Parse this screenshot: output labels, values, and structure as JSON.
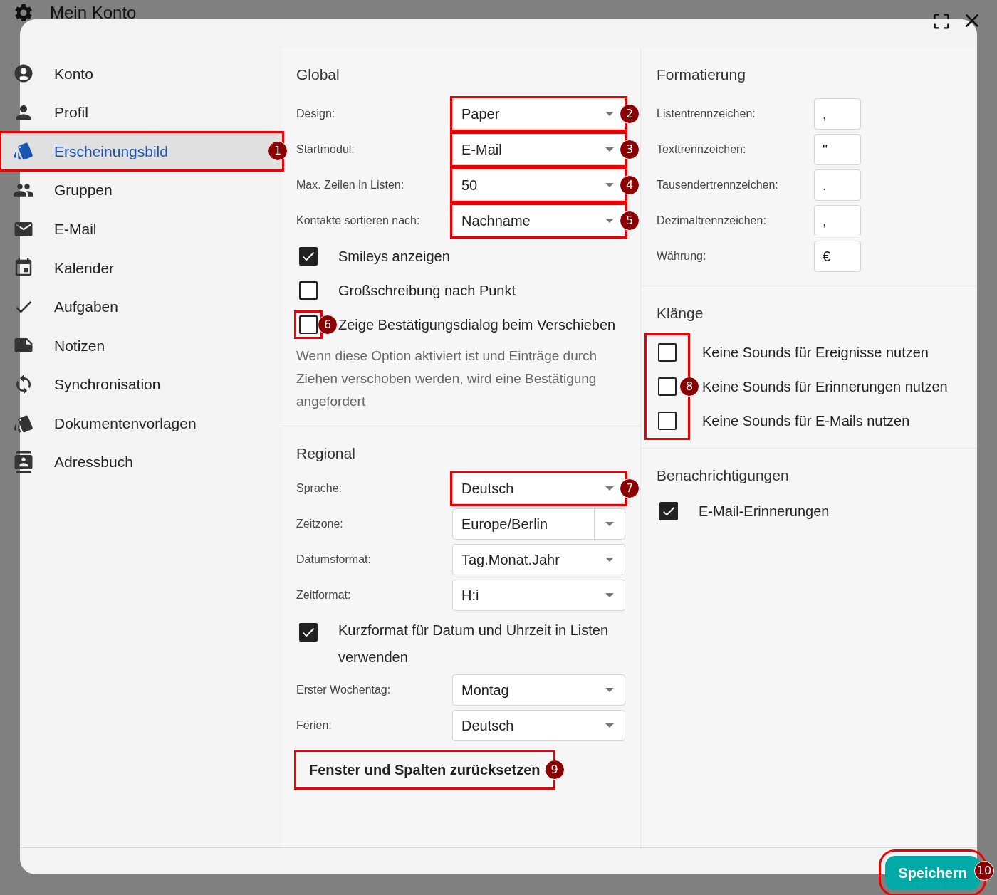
{
  "window": {
    "title": "Mein Konto"
  },
  "sidebar": {
    "items": [
      {
        "kind": "account",
        "label": "Konto",
        "selected": false
      },
      {
        "kind": "person",
        "label": "Profil",
        "selected": false
      },
      {
        "kind": "style",
        "label": "Erscheinungsbild",
        "selected": true,
        "highlighted": true,
        "badge": "1"
      },
      {
        "kind": "people",
        "label": "Gruppen",
        "selected": false
      },
      {
        "kind": "mail",
        "label": "E-Mail",
        "selected": false
      },
      {
        "kind": "calendar",
        "label": "Kalender",
        "selected": false
      },
      {
        "kind": "check",
        "label": "Aufgaben",
        "selected": false
      },
      {
        "kind": "note",
        "label": "Notizen",
        "selected": false
      },
      {
        "kind": "sync",
        "label": "Synchronisation",
        "selected": false
      },
      {
        "kind": "style",
        "label": "Dokumentenvorlagen",
        "selected": false
      },
      {
        "kind": "contacts",
        "label": "Adressbuch",
        "selected": false
      }
    ]
  },
  "global": {
    "heading": "Global",
    "highlighted": true,
    "fields": [
      {
        "kind": "select",
        "label": "Design:",
        "value": "Paper",
        "badge": "2"
      },
      {
        "kind": "select",
        "label": "Startmodul:",
        "value": "E-Mail",
        "badge": "3"
      },
      {
        "kind": "select",
        "label": "Max. Zeilen in Listen:",
        "value": "50",
        "badge": "4"
      },
      {
        "kind": "select",
        "label": "Kontakte sortieren nach:",
        "value": "Nachname",
        "badge": "5"
      }
    ],
    "checkboxes": [
      {
        "label": "Smileys anzeigen",
        "checked": true
      },
      {
        "label": "Großschreibung nach Punkt",
        "checked": false
      },
      {
        "label": "Zeige Bestätigungsdialog beim Verschieben",
        "checked": false,
        "highlighted": true,
        "badge": "6"
      }
    ],
    "hint": "Wenn diese Option aktiviert ist und Einträge durch Ziehen verschoben werden, wird eine Bestätigung angefordert"
  },
  "regional": {
    "heading": "Regional",
    "fields": [
      {
        "kind": "select",
        "label": "Sprache:",
        "value": "Deutsch",
        "highlighted": true,
        "badge": "7"
      },
      {
        "kind": "combo",
        "label": "Zeitzone:",
        "value": "Europe/Berlin"
      },
      {
        "kind": "select",
        "label": "Datumsformat:",
        "value": "Tag.Monat.Jahr"
      },
      {
        "kind": "select",
        "label": "Zeitformat:",
        "value": "H:i"
      }
    ],
    "checkbox": {
      "label": "Kurzformat für Datum und Uhrzeit in Listen verwenden",
      "checked": true
    },
    "more_fields": [
      {
        "kind": "select",
        "label": "Erster Wochentag:",
        "value": "Montag"
      },
      {
        "kind": "select",
        "label": "Ferien:",
        "value": "Deutsch"
      }
    ],
    "reset_button": {
      "label": "Fenster und Spalten zurücksetzen",
      "highlighted": true,
      "badge": "9"
    }
  },
  "formatierung": {
    "heading": "Formatierung",
    "fields": [
      {
        "label": "Listentrennzeichen:",
        "value": ","
      },
      {
        "label": "Texttrennzeichen:",
        "value": "\""
      },
      {
        "label": "Tausendertrennzeichen:",
        "value": "."
      },
      {
        "label": "Dezimaltrennzeichen:",
        "value": ","
      },
      {
        "label": "Währung:",
        "value": "€"
      }
    ]
  },
  "klaenge": {
    "heading": "Klänge",
    "highlighted": true,
    "checkboxes": [
      {
        "label": "Keine Sounds für Ereignisse nutzen",
        "checked": false
      },
      {
        "label": "Keine Sounds für Erinnerungen nutzen",
        "checked": false,
        "badge": "8"
      },
      {
        "label": "Keine Sounds für E-Mails nutzen",
        "checked": false
      }
    ]
  },
  "benachrichtigungen": {
    "heading": "Benachrichtigungen",
    "checkboxes": [
      {
        "label": "E-Mail-Erinnerungen",
        "checked": true
      }
    ]
  },
  "footer": {
    "save_button": {
      "label": "Speichern",
      "highlighted": true,
      "badge": "10"
    }
  }
}
